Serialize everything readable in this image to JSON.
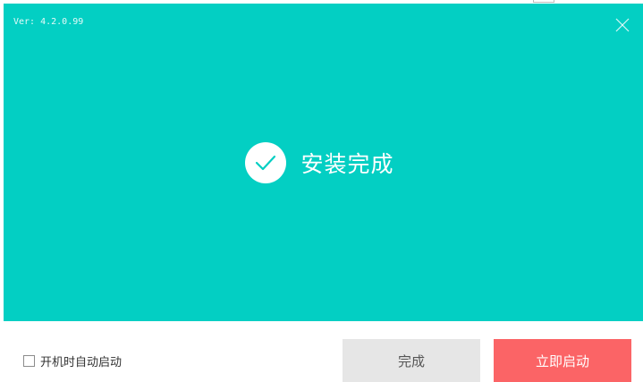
{
  "window": {
    "version": "Ver: 4.2.0.99",
    "status_text": "安装完成"
  },
  "footer": {
    "autostart_label": "开机时自动启动",
    "autostart_checked": false,
    "finish_label": "完成",
    "launch_label": "立即启动"
  },
  "icons": {
    "close": "close-icon",
    "check": "check-icon"
  },
  "colors": {
    "header_bg": "#03cfc3",
    "finish_bg": "#e6e6e6",
    "launch_bg": "#fb6466",
    "text_white": "#ffffff"
  }
}
